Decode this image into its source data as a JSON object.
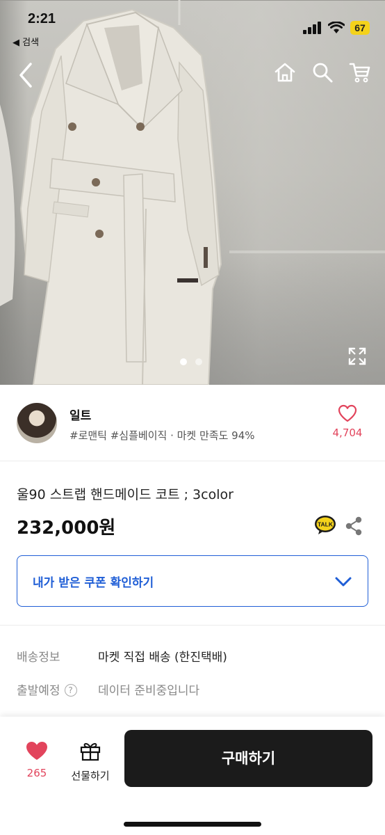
{
  "status_bar": {
    "time": "2:21",
    "back_label": "◀ 검색",
    "battery": "67"
  },
  "gallery": {
    "image_count": 2,
    "active_index": 0
  },
  "seller": {
    "name": "일트",
    "tags": "#로맨틱 #심플베이직 · 마켓 만족도 94%",
    "like_count": "4,704"
  },
  "product": {
    "title": "울90 스트랩 핸드메이드 코트 ; 3color",
    "price": "232,000원"
  },
  "coupon": {
    "label": "내가 받은 쿠폰 확인하기"
  },
  "shipping": {
    "label": "배송정보",
    "value": "마켓 직접 배송 (한진택배)"
  },
  "departure": {
    "label": "출발예정",
    "help": "?",
    "value": "데이터 준비중입니다"
  },
  "bottom_bar": {
    "wish_count": "265",
    "gift_label": "선물하기",
    "buy_label": "구매하기"
  },
  "colors": {
    "accent_blue": "#1f5ed6",
    "like_red": "#e2445c",
    "buy_button": "#1b1b1b",
    "battery": "#f4d21b"
  }
}
